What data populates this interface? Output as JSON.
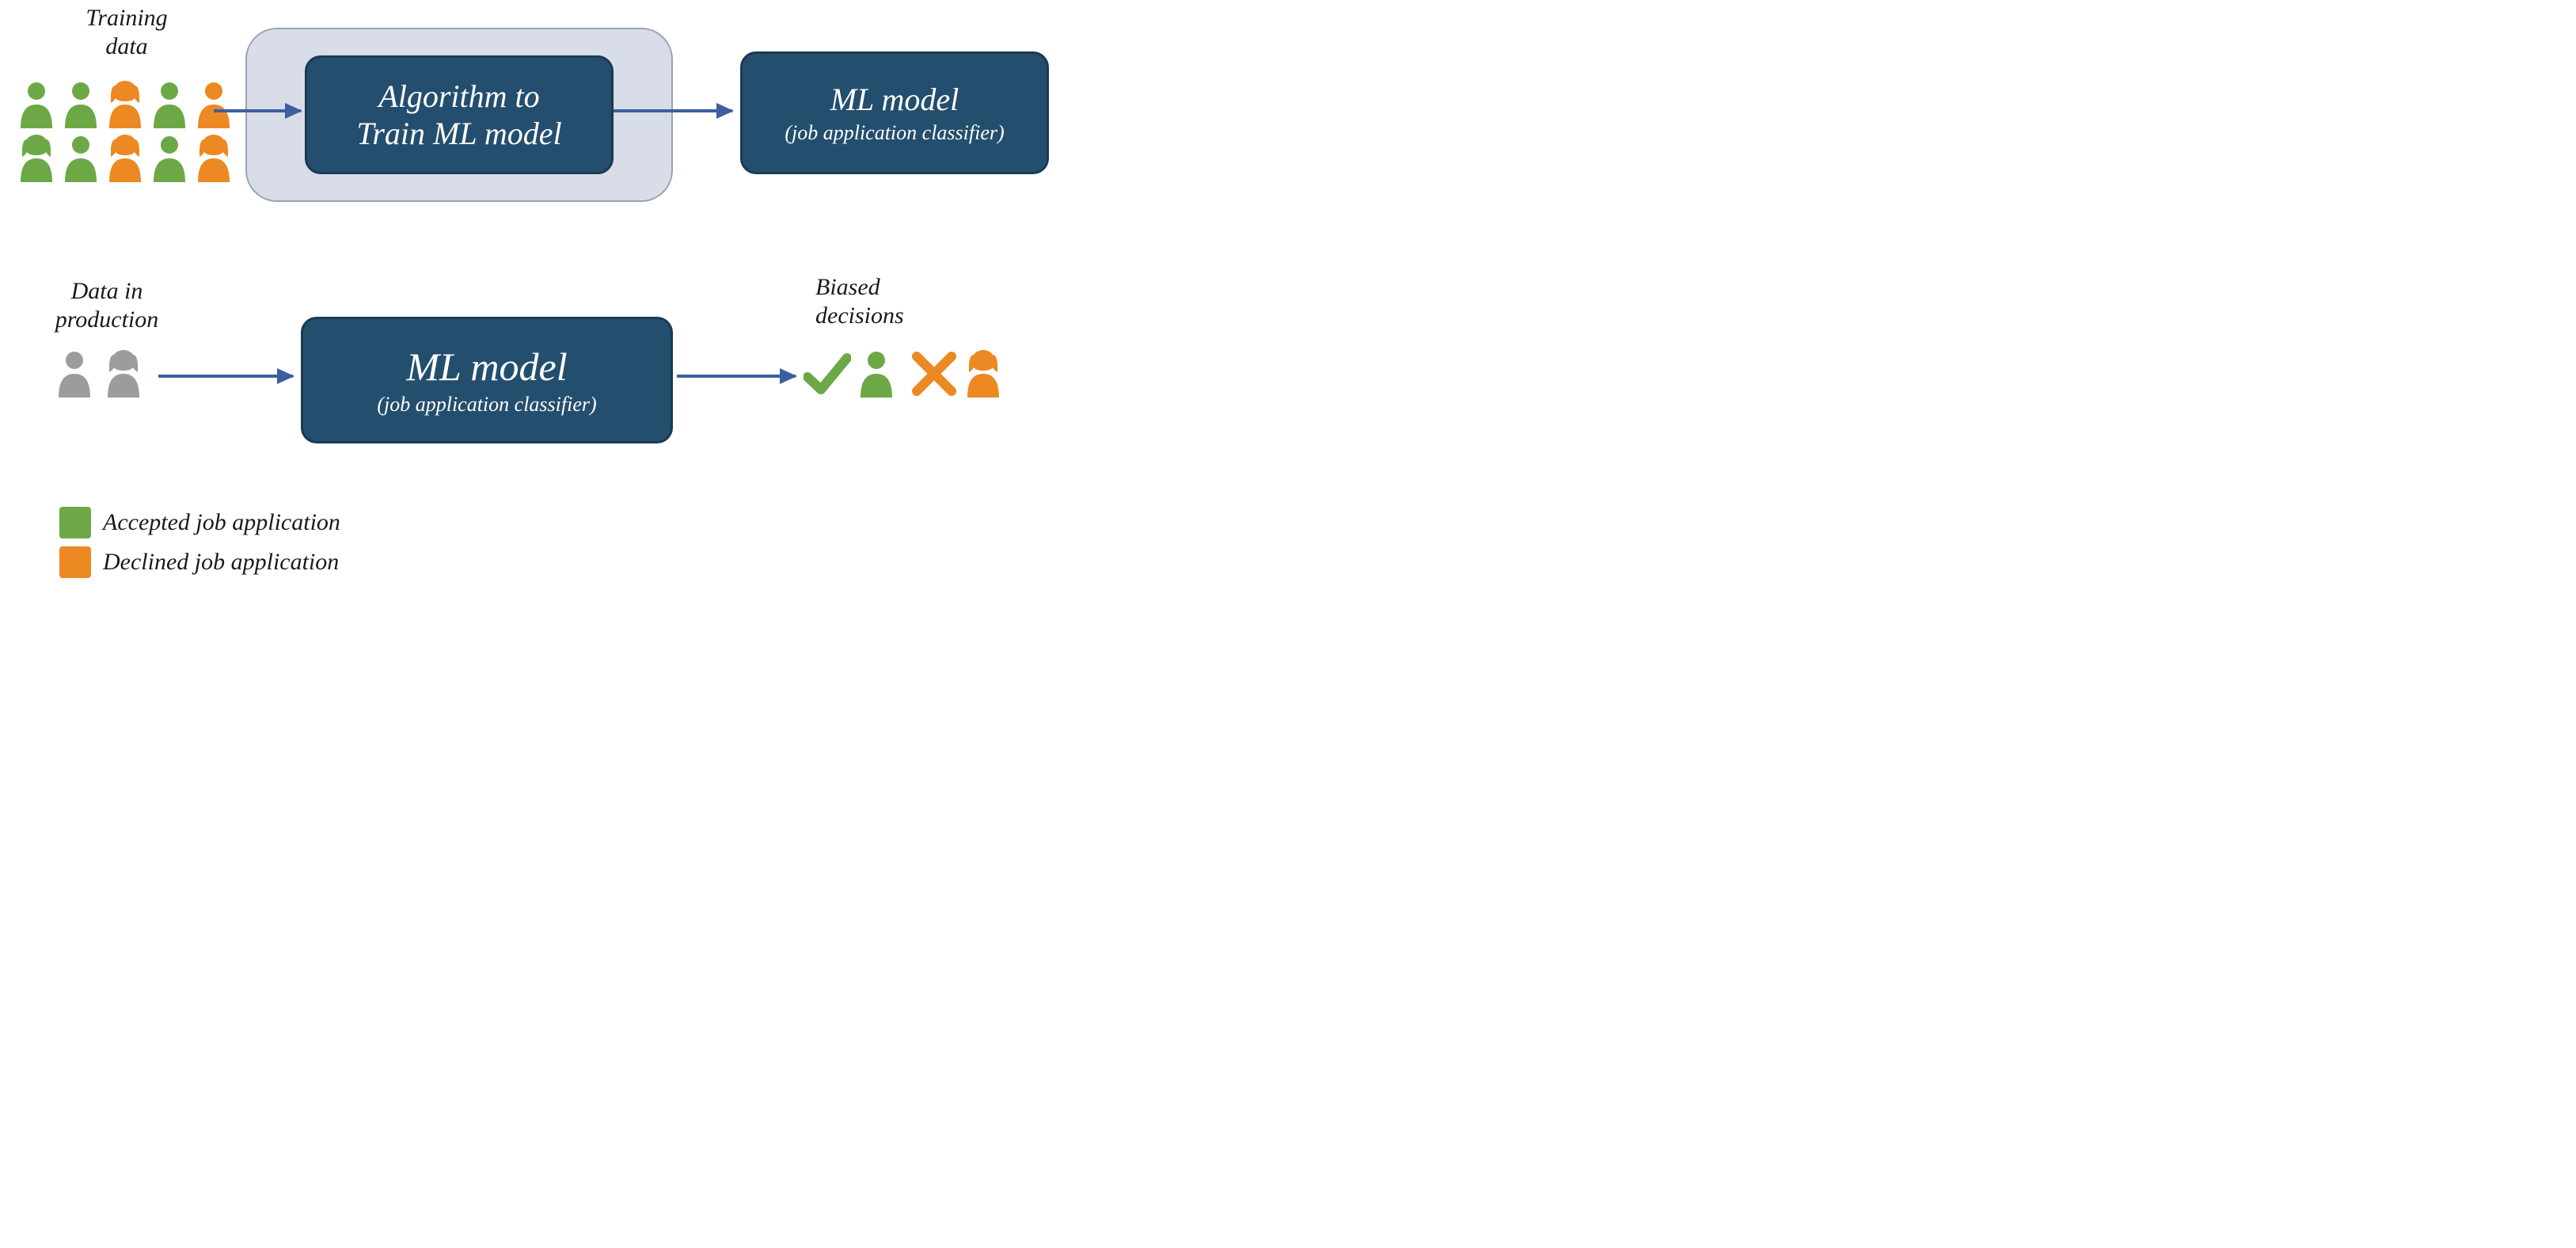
{
  "labels": {
    "training_data": "Training\ndata",
    "data_in_production": "Data in\nproduction",
    "biased_decisions": "Biased\ndecisions",
    "algorithm_box": "Algorithm to\nTrain ML model",
    "ml_model_title": "ML model",
    "ml_model_sub": "(job application classifier)",
    "legend_accepted": "Accepted job application",
    "legend_declined": "Declined job application"
  },
  "colors": {
    "accepted": "#6da847",
    "declined": "#ec8923",
    "neutral": "#9c9c9c",
    "box": "#244e6e",
    "outer": "#d8dde8",
    "arrow": "#3d5fa0"
  },
  "training_people": [
    {
      "gender": "male",
      "status": "accepted"
    },
    {
      "gender": "male",
      "status": "accepted"
    },
    {
      "gender": "female",
      "status": "declined"
    },
    {
      "gender": "male",
      "status": "accepted"
    },
    {
      "gender": "male",
      "status": "declined"
    },
    {
      "gender": "female",
      "status": "accepted"
    },
    {
      "gender": "male",
      "status": "accepted"
    },
    {
      "gender": "female",
      "status": "declined"
    },
    {
      "gender": "male",
      "status": "accepted"
    },
    {
      "gender": "female",
      "status": "declined"
    }
  ],
  "production_people": [
    {
      "gender": "male",
      "status": "neutral"
    },
    {
      "gender": "female",
      "status": "neutral"
    }
  ],
  "results": [
    {
      "mark": "check",
      "gender": "male",
      "status": "accepted"
    },
    {
      "mark": "cross",
      "gender": "female",
      "status": "declined"
    }
  ]
}
